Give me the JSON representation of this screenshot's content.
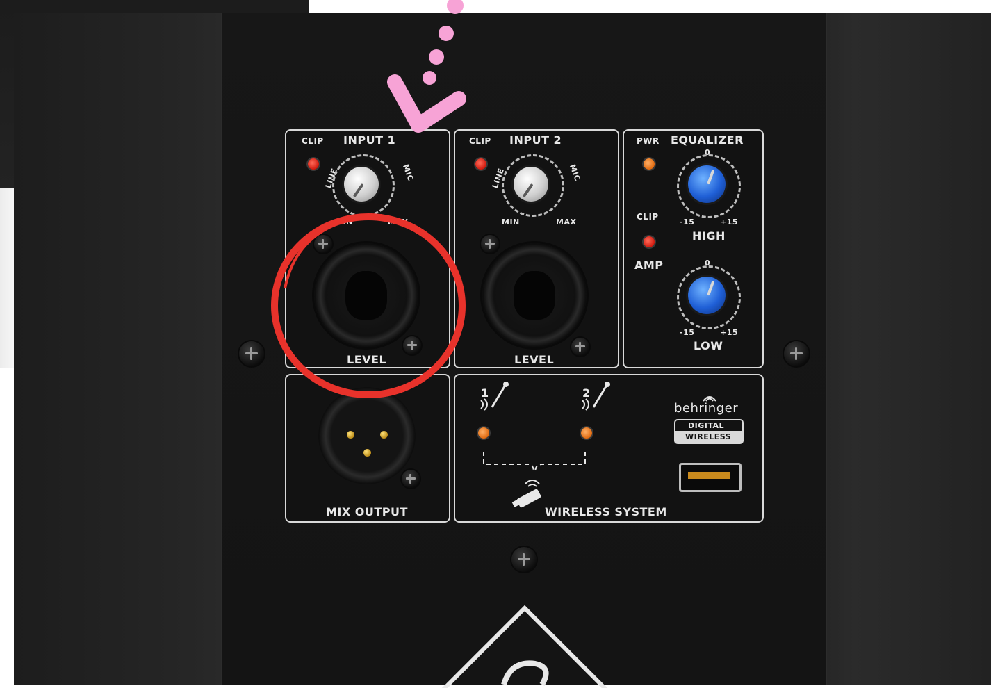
{
  "input1": {
    "title": "INPUT 1",
    "clip": "CLIP",
    "line": "LINE",
    "mic": "MIC",
    "min": "MIN",
    "max": "MAX",
    "level": "LEVEL"
  },
  "input2": {
    "title": "INPUT 2",
    "clip": "CLIP",
    "line": "LINE",
    "mic": "MIC",
    "min": "MIN",
    "max": "MAX",
    "level": "LEVEL"
  },
  "equalizer": {
    "pwr": "PWR",
    "title": "EQUALIZER",
    "clip": "CLIP",
    "amp": "AMP",
    "high": {
      "label": "HIGH",
      "zero": "0",
      "min": "-15",
      "max": "+15"
    },
    "low": {
      "label": "LOW",
      "zero": "0",
      "min": "-15",
      "max": "+15"
    }
  },
  "mix_output": "MIX OUTPUT",
  "wireless": {
    "title": "WIRELESS SYSTEM",
    "ch1": "1",
    "ch2": "2",
    "brand": "behringer",
    "digital": "DIGITAL",
    "wireless_label": "WIRELESS"
  },
  "colors": {
    "annotation_circle": "#e8322b",
    "annotation_arrow": "#f7a3d6",
    "led_red": "#d01a0e",
    "led_amber": "#e06a10",
    "knob_blue": "#1f5fd6"
  },
  "icons": [
    "screw-icon",
    "microphone-icon",
    "wireless-dongle-icon",
    "usb-port-icon",
    "behringer-logo"
  ]
}
